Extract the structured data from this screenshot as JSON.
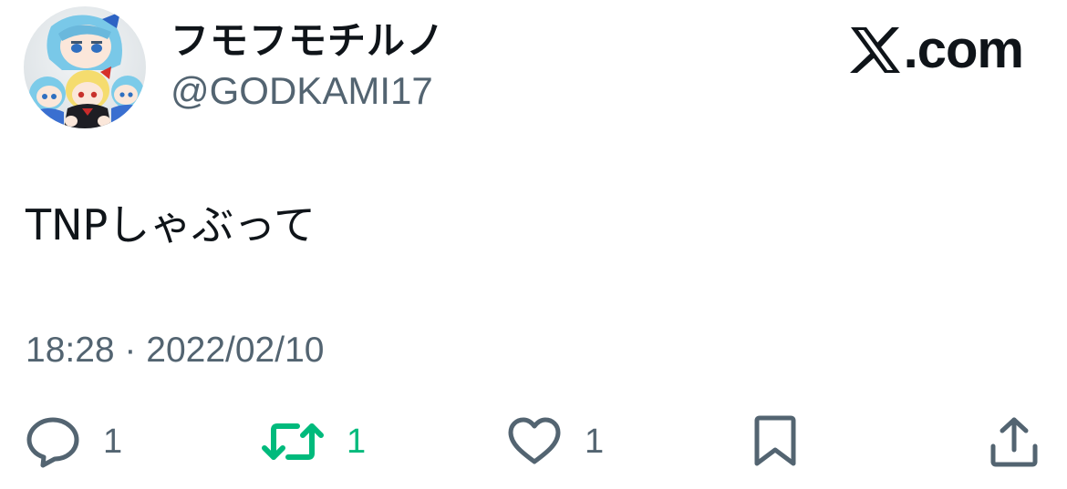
{
  "author": {
    "display_name": "フモフモチルノ",
    "handle": "@GODKAMI17",
    "avatar_icon": "avatar-plush-dolls"
  },
  "brand": {
    "logo_icon": "x-logo-icon",
    "domain_text": ".com"
  },
  "tweet": {
    "text": "TNPしゃぶって",
    "timestamp": "18:28 · 2022/02/10"
  },
  "actions": {
    "reply": {
      "icon": "reply-icon",
      "count": "1"
    },
    "retweet": {
      "icon": "retweet-icon",
      "count": "1"
    },
    "like": {
      "icon": "heart-icon",
      "count": "1"
    },
    "bookmark": {
      "icon": "bookmark-icon"
    },
    "share": {
      "icon": "share-icon"
    }
  },
  "colors": {
    "text_primary": "#0f1419",
    "text_secondary": "#536471",
    "retweet_active": "#00ba7c",
    "background": "#ffffff"
  }
}
